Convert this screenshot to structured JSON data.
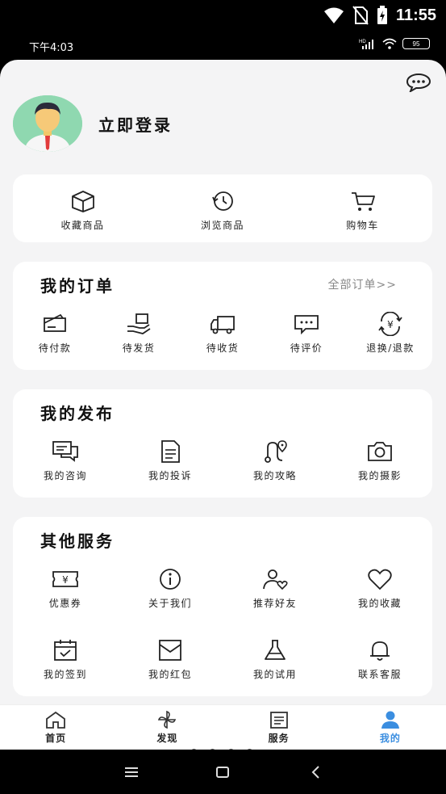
{
  "system": {
    "time": "11:55"
  },
  "inner_status": {
    "time": "下午4:03",
    "battery": "95"
  },
  "profile": {
    "login_label": "立即登录"
  },
  "quick": [
    {
      "label": "收藏商品",
      "icon": "box-icon"
    },
    {
      "label": "浏览商品",
      "icon": "history-icon"
    },
    {
      "label": "购物车",
      "icon": "cart-icon"
    }
  ],
  "orders": {
    "title": "我的订单",
    "all_link": "全部订单>>",
    "items": [
      {
        "label": "待付款",
        "icon": "wallet-icon"
      },
      {
        "label": "待发货",
        "icon": "ship-icon"
      },
      {
        "label": "待收货",
        "icon": "truck-icon"
      },
      {
        "label": "待评价",
        "icon": "comment-icon"
      },
      {
        "label": "退换/退款",
        "icon": "refund-icon"
      }
    ]
  },
  "publish": {
    "title": "我的发布",
    "items": [
      {
        "label": "我的咨询",
        "icon": "chat-icon"
      },
      {
        "label": "我的投诉",
        "icon": "document-icon"
      },
      {
        "label": "我的攻略",
        "icon": "route-icon"
      },
      {
        "label": "我的摄影",
        "icon": "camera-icon"
      }
    ]
  },
  "services": {
    "title": "其他服务",
    "items": [
      {
        "label": "优惠券",
        "icon": "coupon-icon"
      },
      {
        "label": "关于我们",
        "icon": "info-icon"
      },
      {
        "label": "推荐好友",
        "icon": "user-heart-icon"
      },
      {
        "label": "我的收藏",
        "icon": "heart-icon"
      },
      {
        "label": "我的签到",
        "icon": "calendar-check-icon"
      },
      {
        "label": "我的红包",
        "icon": "envelope-icon"
      },
      {
        "label": "我的试用",
        "icon": "flask-icon"
      },
      {
        "label": "联系客服",
        "icon": "bell-icon"
      }
    ]
  },
  "tabs": [
    {
      "label": "首页",
      "icon": "home-icon"
    },
    {
      "label": "发现",
      "icon": "pinwheel-icon"
    },
    {
      "label": "服务",
      "icon": "list-icon"
    },
    {
      "label": "我的",
      "icon": "user-icon"
    }
  ],
  "colors": {
    "accent": "#3b8ee0",
    "background": "#f4f4f5",
    "card": "#ffffff"
  }
}
